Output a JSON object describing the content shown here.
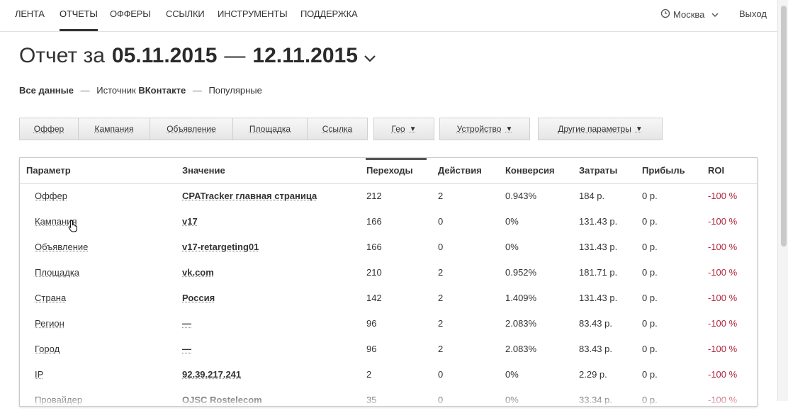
{
  "nav": {
    "items": [
      "ЛЕНТА",
      "ОТЧЕТЫ",
      "ОФФЕРЫ",
      "ССЫЛКИ",
      "ИНСТРУМЕНТЫ",
      "ПОДДЕРЖКА"
    ],
    "active": "ОТЧЕТЫ",
    "city": "Москва",
    "logout": "Выход"
  },
  "report": {
    "title_prefix": "Отчет за",
    "date_from": "05.11.2015",
    "dash": "—",
    "date_to": "12.11.2015"
  },
  "breadcrumbs": {
    "all": "Все данные",
    "source_label": "Источник",
    "source_value": "ВКонтакте",
    "popular": "Популярные"
  },
  "filters": [
    "Оффер",
    "Кампания",
    "Объявление",
    "Площадка",
    "Ссылка",
    "Гео",
    "Устройство",
    "Другие параметры"
  ],
  "table": {
    "headers": [
      "Параметр",
      "Значение",
      "Переходы",
      "Действия",
      "Конверсия",
      "Затраты",
      "Прибыль",
      "ROI"
    ],
    "rows": [
      [
        "Оффер",
        "CPATracker главная страница",
        "212",
        "2",
        "0.943%",
        "184 р.",
        "0 р.",
        "-100 %"
      ],
      [
        "Кампания",
        "v17",
        "166",
        "0",
        "0%",
        "131.43 р.",
        "0 р.",
        "-100 %"
      ],
      [
        "Объявление",
        "v17-retargeting01",
        "166",
        "0",
        "0%",
        "131.43 р.",
        "0 р.",
        "-100 %"
      ],
      [
        "Площадка",
        "vk.com",
        "210",
        "2",
        "0.952%",
        "181.71 р.",
        "0 р.",
        "-100 %"
      ],
      [
        "Страна",
        "Россия",
        "142",
        "2",
        "1.409%",
        "131.43 р.",
        "0 р.",
        "-100 %"
      ],
      [
        "Регион",
        "—",
        "96",
        "2",
        "2.083%",
        "83.43 р.",
        "0 р.",
        "-100 %"
      ],
      [
        "Город",
        "—",
        "96",
        "2",
        "2.083%",
        "83.43 р.",
        "0 р.",
        "-100 %"
      ],
      [
        "IP",
        "92.39.217.241",
        "2",
        "0",
        "0%",
        "2.29 р.",
        "0 р.",
        "-100 %"
      ],
      [
        "Провайдер",
        "OJSC Rostelecom",
        "35",
        "0",
        "0%",
        "33.34 р.",
        "0 р.",
        "-100 %"
      ]
    ]
  },
  "colors": {
    "roi": "#b0263a",
    "accent": "#333333"
  },
  "icons": {
    "city": "clock-icon",
    "dropdown": "chevron-down-icon",
    "cursor": "hand-pointer-icon"
  }
}
